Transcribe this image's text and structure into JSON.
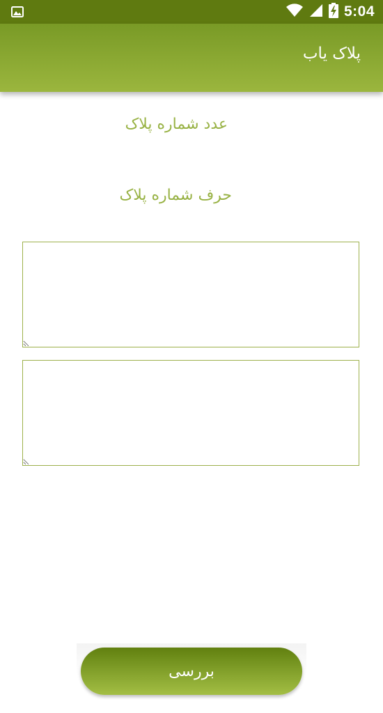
{
  "status_bar": {
    "time": "5:04",
    "icons": [
      "image-icon",
      "wifi-icon",
      "signal-icon",
      "battery-charging-icon"
    ]
  },
  "toolbar": {
    "title": "پلاک یاب"
  },
  "form": {
    "number_label": "عدد شماره پلاک",
    "letter_label": "حرف شماره پلاک",
    "number_input_value": "",
    "letter_input_value": ""
  },
  "actions": {
    "check_label": "بررسی"
  },
  "colors": {
    "status_bar": "#5f7a10",
    "toolbar_top": "#799a26",
    "toolbar_bottom": "#9bb63e",
    "label_text": "#98b244",
    "input_border": "#9cb04a",
    "button_dark": "#61800f",
    "button_light": "#a3be44"
  }
}
